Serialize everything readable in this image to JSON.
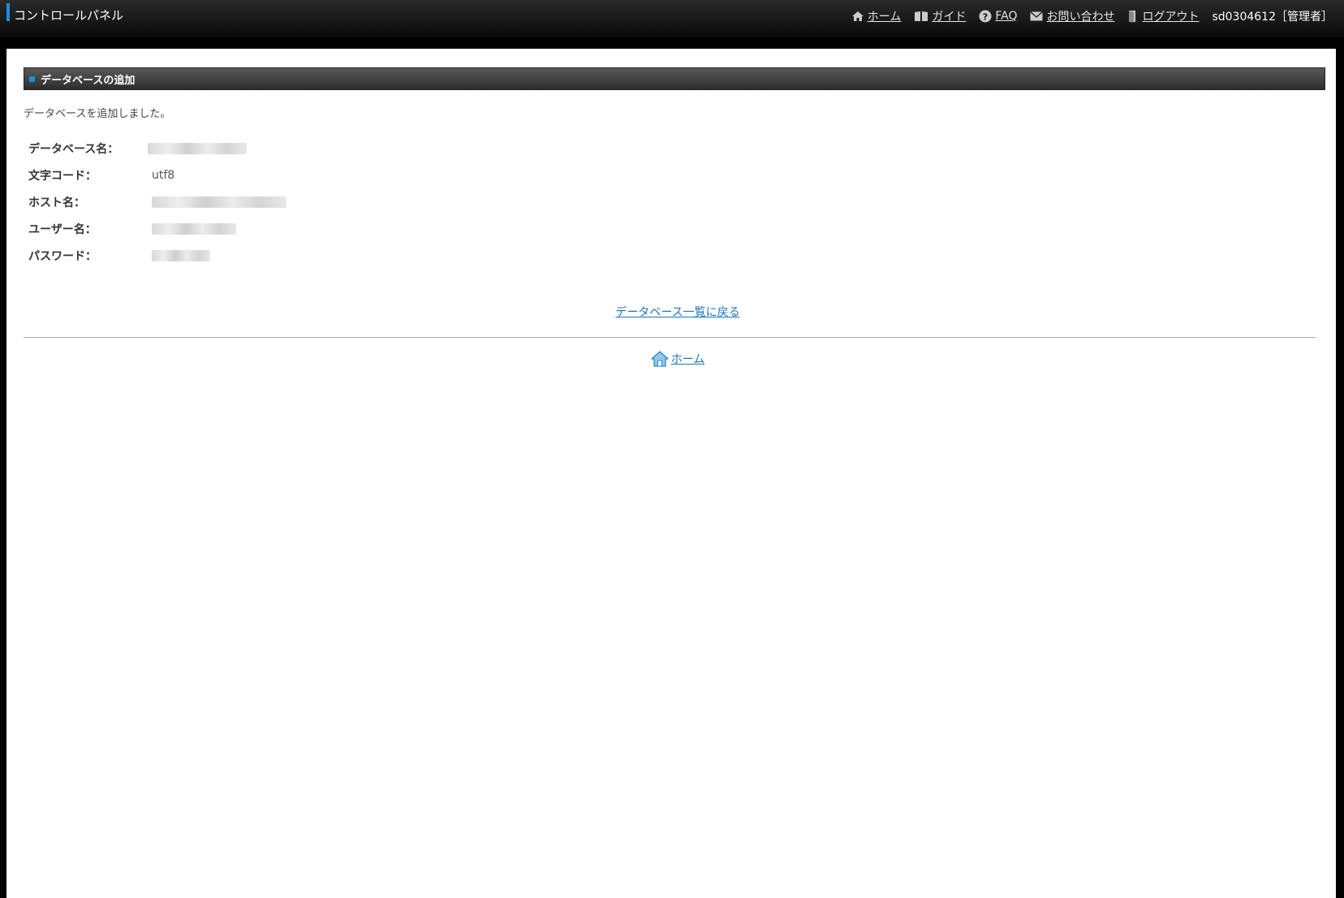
{
  "app": {
    "title": "コントロールパネル"
  },
  "nav": {
    "home": "ホーム",
    "guide": "ガイド",
    "faq": "FAQ",
    "contact": "お問い合わせ",
    "logout": "ログアウト",
    "user": "sd0304612［管理者］"
  },
  "section": {
    "title": "データベースの追加"
  },
  "message": "データベースを追加しました。",
  "details": {
    "db_name_label": "データベース名：",
    "charset_label": "文字コード：",
    "charset_value": "utf8",
    "host_label": "ホスト名：",
    "user_label": "ユーザー名：",
    "password_label": "パスワード："
  },
  "links": {
    "back": "データベース一覧に戻る",
    "home": "ホーム"
  },
  "colors": {
    "accent": "#1a8fe0",
    "link": "#1a75bc"
  }
}
